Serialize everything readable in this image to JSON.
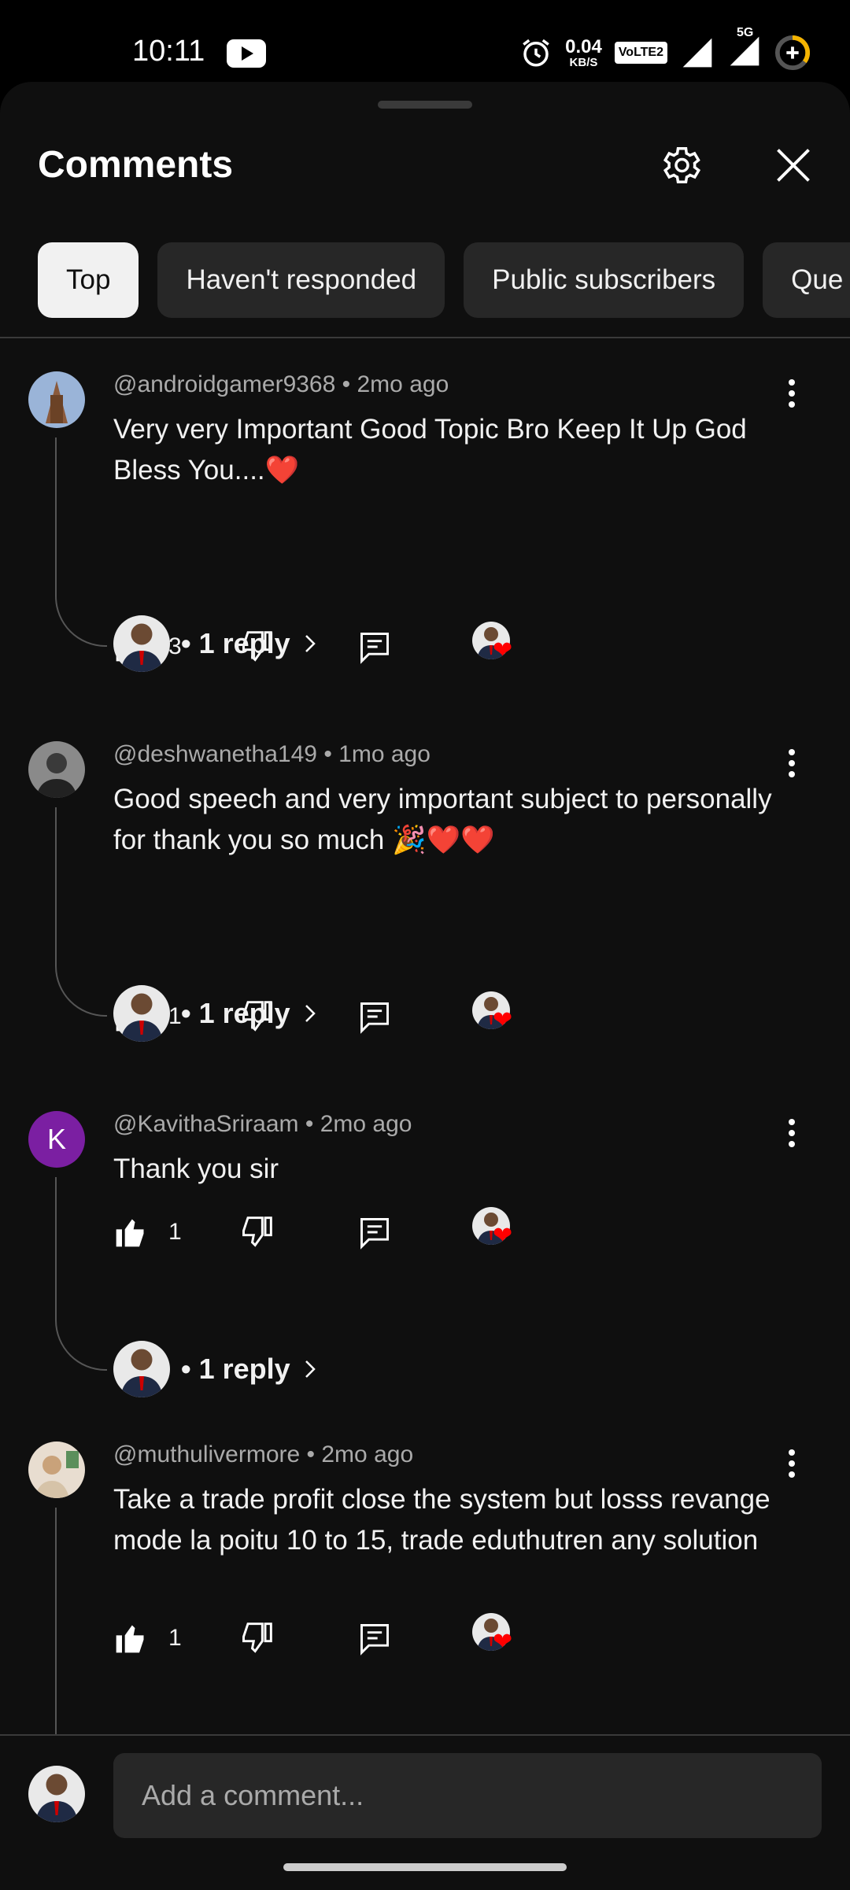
{
  "status": {
    "time": "10:11",
    "net_speed": "0.04",
    "net_unit": "KB/S",
    "volte": "VoLTE2",
    "network": "5G"
  },
  "header": {
    "title": "Comments"
  },
  "filters": [
    "Top",
    "Haven't responded",
    "Public subscribers",
    "Que"
  ],
  "comments": [
    {
      "handle": "@androidgamer9368",
      "time": "2mo ago",
      "text": "Very very Important Good Topic Bro Keep It Up God Bless You....❤️",
      "likes": "3",
      "reply_label": "• 1 reply"
    },
    {
      "handle": "@deshwanetha149",
      "time": "1mo ago",
      "text": "Good speech and very important subject to personally for thank you so much 🎉❤️❤️",
      "likes": "1",
      "reply_label": "• 1 reply"
    },
    {
      "handle": "@KavithaSriraam",
      "time": "2mo ago",
      "text": "Thank you sir",
      "likes": "1",
      "reply_label": "• 1 reply",
      "avatar_letter": "K"
    },
    {
      "handle": "@muthulivermore",
      "time": "2mo ago",
      "text": "Take a trade profit close the system but losss revange mode la poitu 10 to 15, trade eduthutren any solution",
      "likes": "1"
    }
  ],
  "composer": {
    "placeholder": "Add a comment..."
  },
  "colors": {
    "accent_red": "#ff0000",
    "chip_active": "#f1f1f1",
    "chip": "#272727",
    "avatar_k": "#7b1fa2"
  }
}
